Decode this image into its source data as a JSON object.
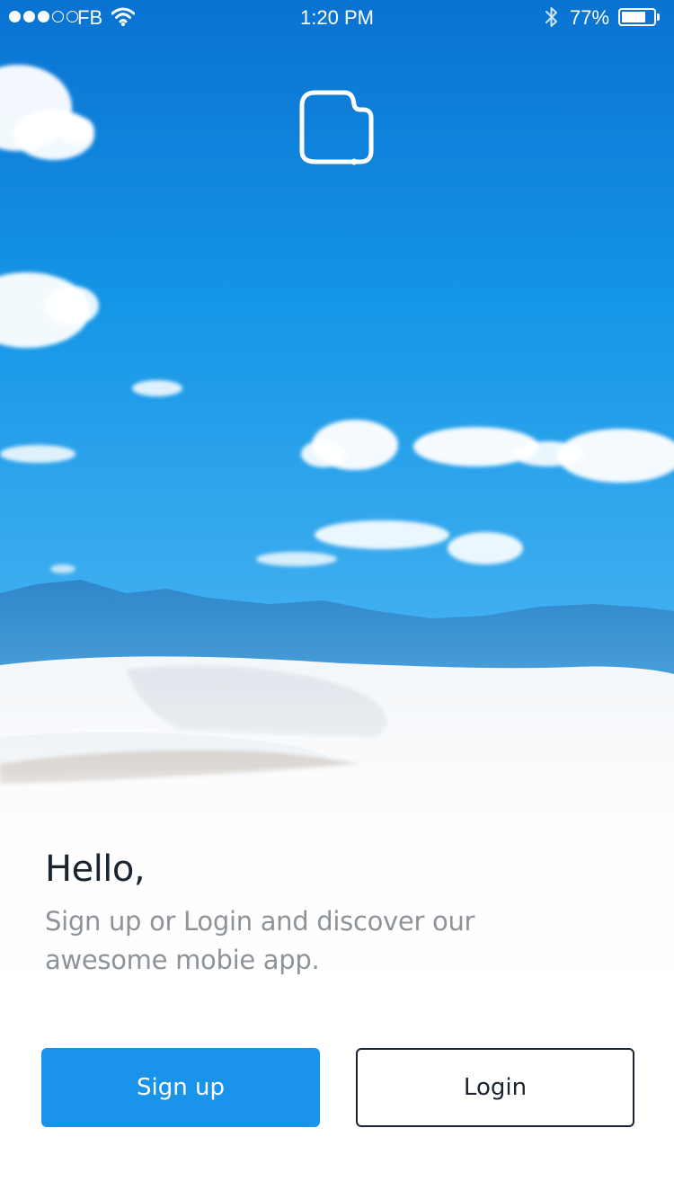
{
  "status_bar": {
    "carrier": "FB",
    "time": "1:20 PM",
    "battery_percent": "77%",
    "battery_level": 0.77,
    "signal_bars_filled": 3,
    "signal_bars_total": 5,
    "icons": [
      "signal-dots-icon",
      "wifi-icon",
      "bluetooth-icon",
      "battery-icon"
    ]
  },
  "logo": {
    "icon": "app-logo-icon"
  },
  "welcome": {
    "greeting": "Hello,",
    "subtitle": "Sign up or Login and discover our awesome mobie app."
  },
  "actions": {
    "signup_label": "Sign up",
    "login_label": "Login"
  },
  "colors": {
    "primary": "#1a93ea",
    "text_dark": "#1b2530",
    "text_muted": "#8e9399",
    "sky_top": "#0a78d6",
    "sky_bottom": "#45b0f0"
  }
}
